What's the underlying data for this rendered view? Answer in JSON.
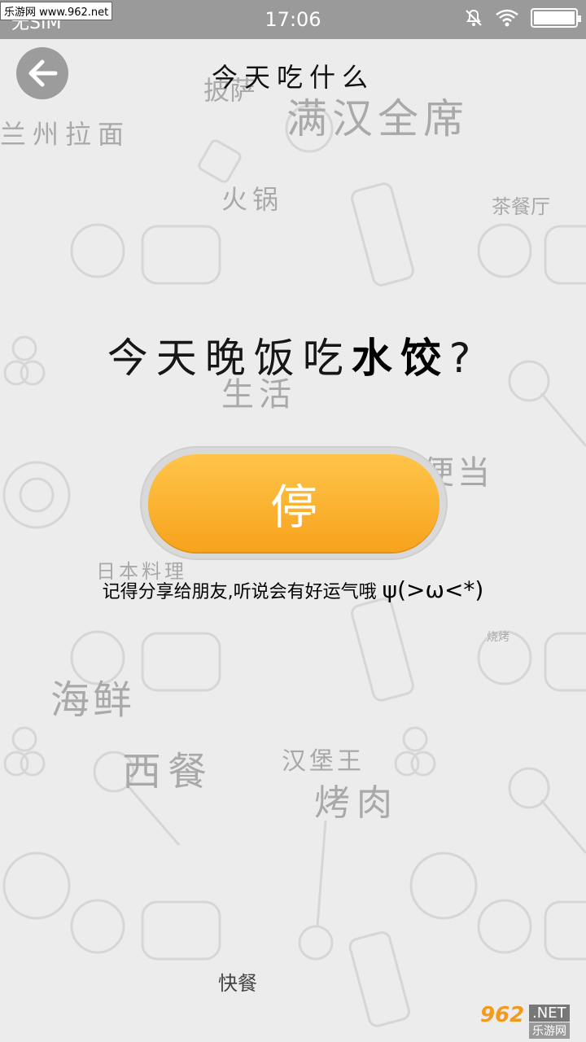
{
  "status_bar": {
    "carrier": "无SIM",
    "watermark": "乐游网 www.962.net",
    "time": "17:06",
    "icons": [
      "mute-icon",
      "wifi-icon",
      "battery-icon"
    ]
  },
  "header": {
    "title": "今天吃什么",
    "back_icon": "arrow-left-icon"
  },
  "question": {
    "prefix": "今天晚饭吃",
    "dish": "水饺",
    "suffix": "?"
  },
  "stop_button": {
    "label": "停"
  },
  "share_tip": {
    "text": "记得分享给朋友,听说会有好运气哦",
    "kaomoji": "ψ(>ω<*)"
  },
  "background_words": [
    "披萨",
    "满汉全席",
    "兰州拉面",
    "火锅",
    "茶餐厅",
    "生活",
    "自家便当",
    "日本料理",
    "烧烤",
    "海鲜",
    "西餐",
    "汉堡王",
    "烤肉",
    "快餐"
  ],
  "corner_logo": {
    "number": "962",
    "net": ".NET",
    "site": "乐游网"
  },
  "colors": {
    "accent": "#f7a31c",
    "status_bar": "#9a9a9a",
    "background": "#ececec"
  }
}
